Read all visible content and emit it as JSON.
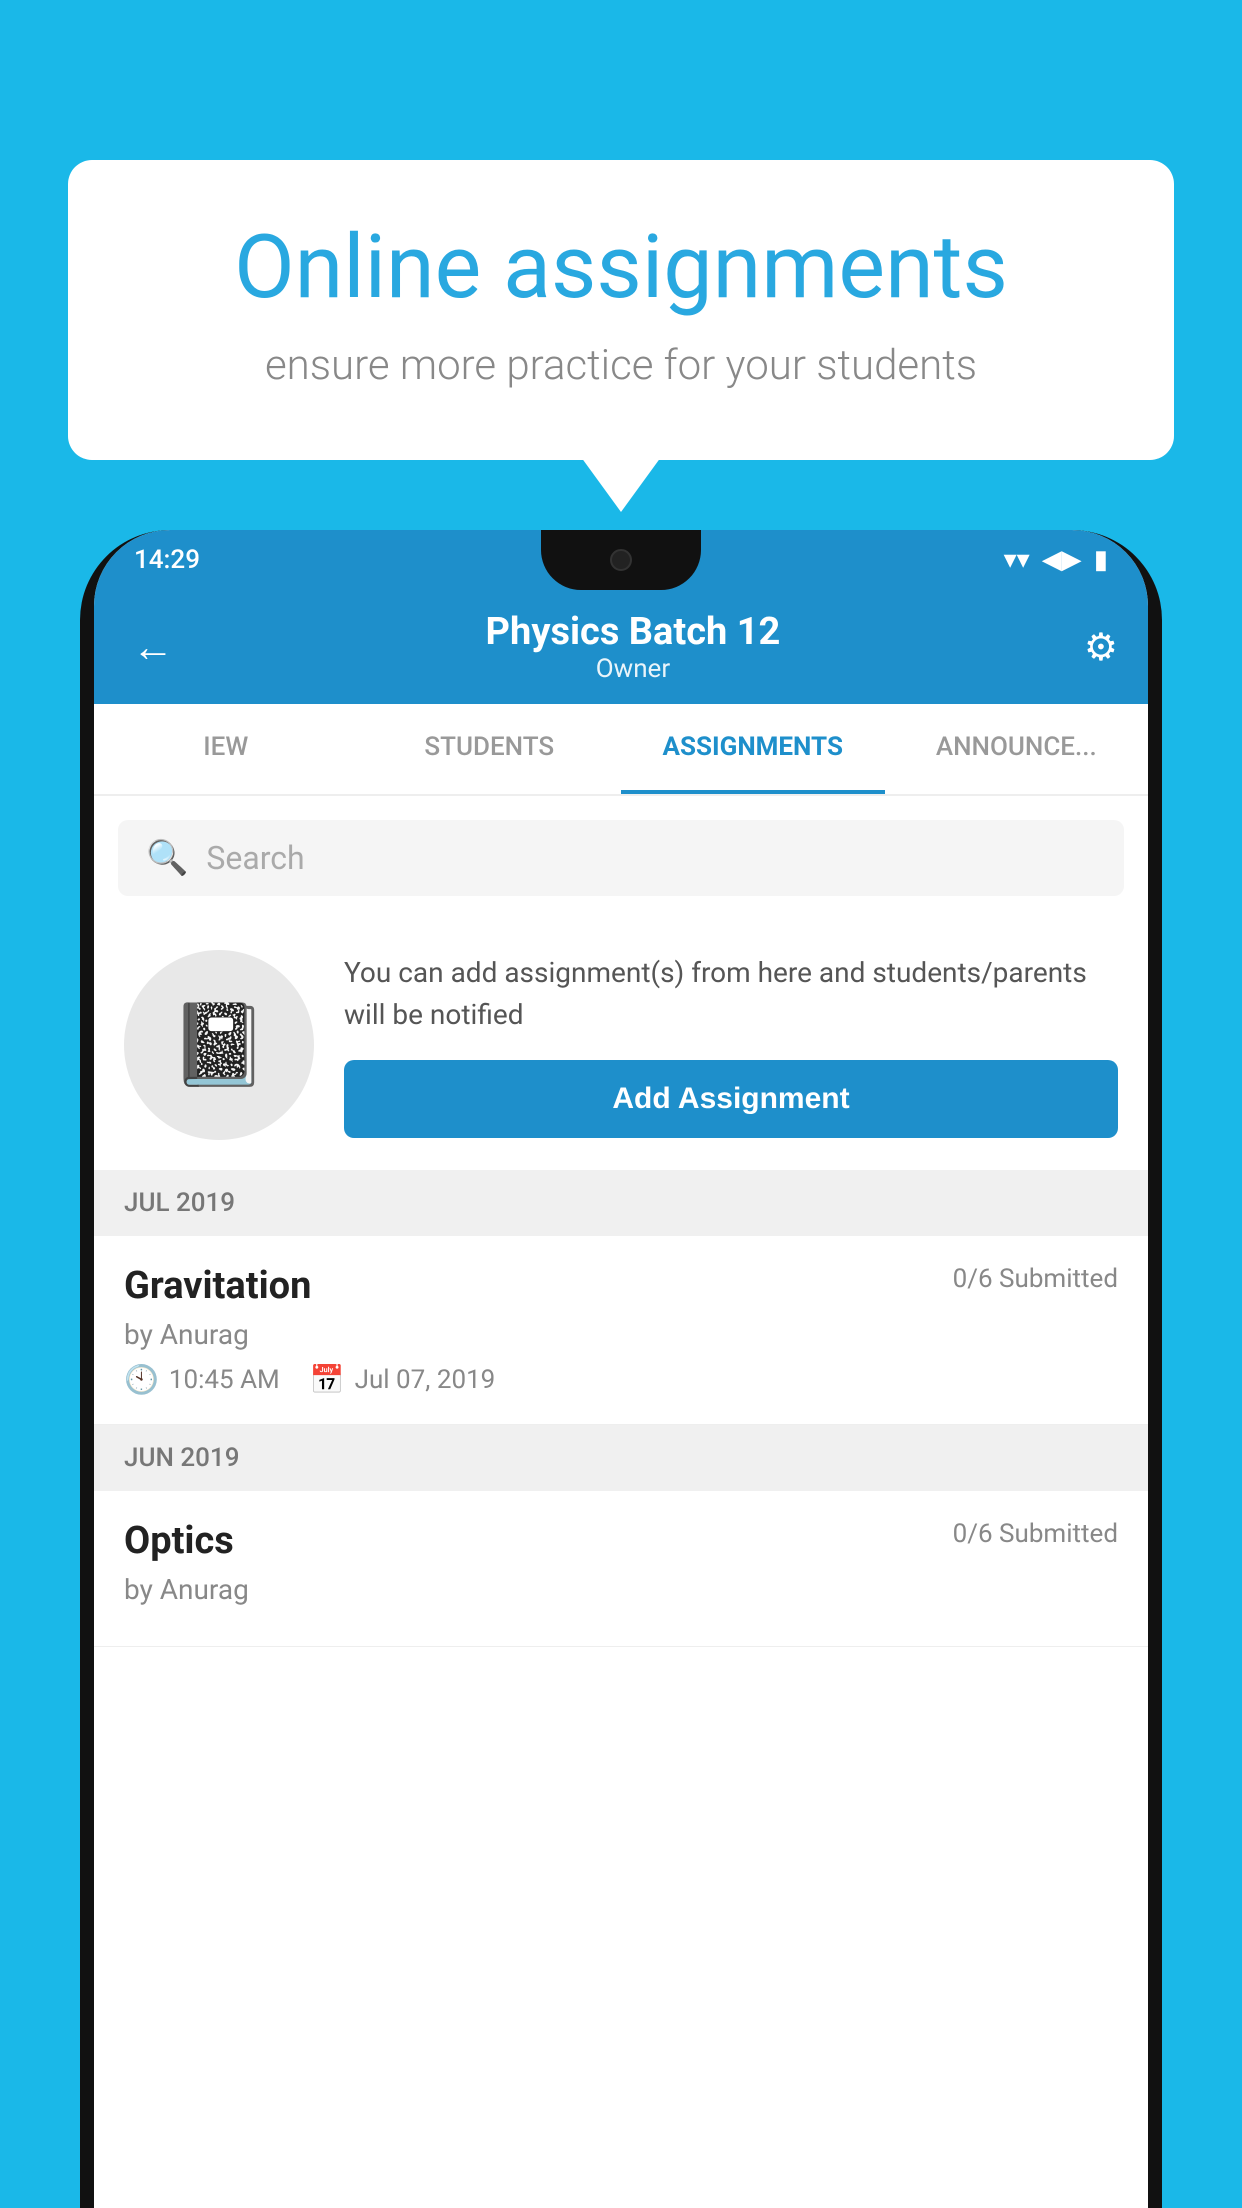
{
  "background_color": "#1AB8E8",
  "speech_bubble": {
    "title": "Online assignments",
    "subtitle": "ensure more practice for your students"
  },
  "status_bar": {
    "time": "14:29"
  },
  "header": {
    "title": "Physics Batch 12",
    "subtitle": "Owner",
    "back_label": "←",
    "settings_label": "⚙"
  },
  "tabs": [
    {
      "label": "IEW",
      "active": false
    },
    {
      "label": "STUDENTS",
      "active": false
    },
    {
      "label": "ASSIGNMENTS",
      "active": true
    },
    {
      "label": "ANNOUNCEMENTS",
      "active": false
    }
  ],
  "search": {
    "placeholder": "Search"
  },
  "promo": {
    "text": "You can add assignment(s) from here and students/parents will be notified",
    "add_button_label": "Add Assignment"
  },
  "sections": [
    {
      "month_label": "JUL 2019",
      "assignments": [
        {
          "name": "Gravitation",
          "submitted": "0/6 Submitted",
          "author": "by Anurag",
          "time": "10:45 AM",
          "date": "Jul 07, 2019"
        }
      ]
    },
    {
      "month_label": "JUN 2019",
      "assignments": [
        {
          "name": "Optics",
          "submitted": "0/6 Submitted",
          "author": "by Anurag",
          "time": "",
          "date": ""
        }
      ]
    }
  ]
}
